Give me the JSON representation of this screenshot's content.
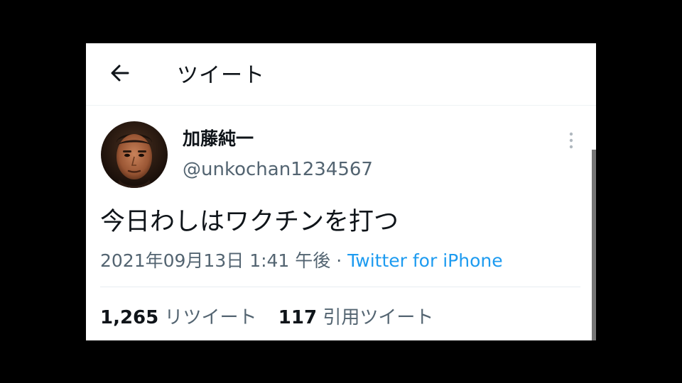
{
  "header": {
    "title": "ツイート",
    "back_icon": "arrow-left-icon"
  },
  "tweet": {
    "author_name": "加藤純一",
    "author_handle": "@unkochan1234567",
    "text": "今日わしはワクチンを打つ",
    "timestamp": "2021年09月13日 1:41 午後",
    "separator": "·",
    "source": "Twitter for iPhone",
    "more_icon": "more-vertical-icon",
    "stats": {
      "retweets_count": "1,265",
      "retweets_label": "リツイート",
      "quotes_count": "117",
      "quotes_label": "引用ツイート"
    }
  },
  "colors": {
    "background": "#000000",
    "card": "#ffffff",
    "text_primary": "#0f1419",
    "text_secondary": "#536471",
    "link": "#1d9bf0"
  }
}
